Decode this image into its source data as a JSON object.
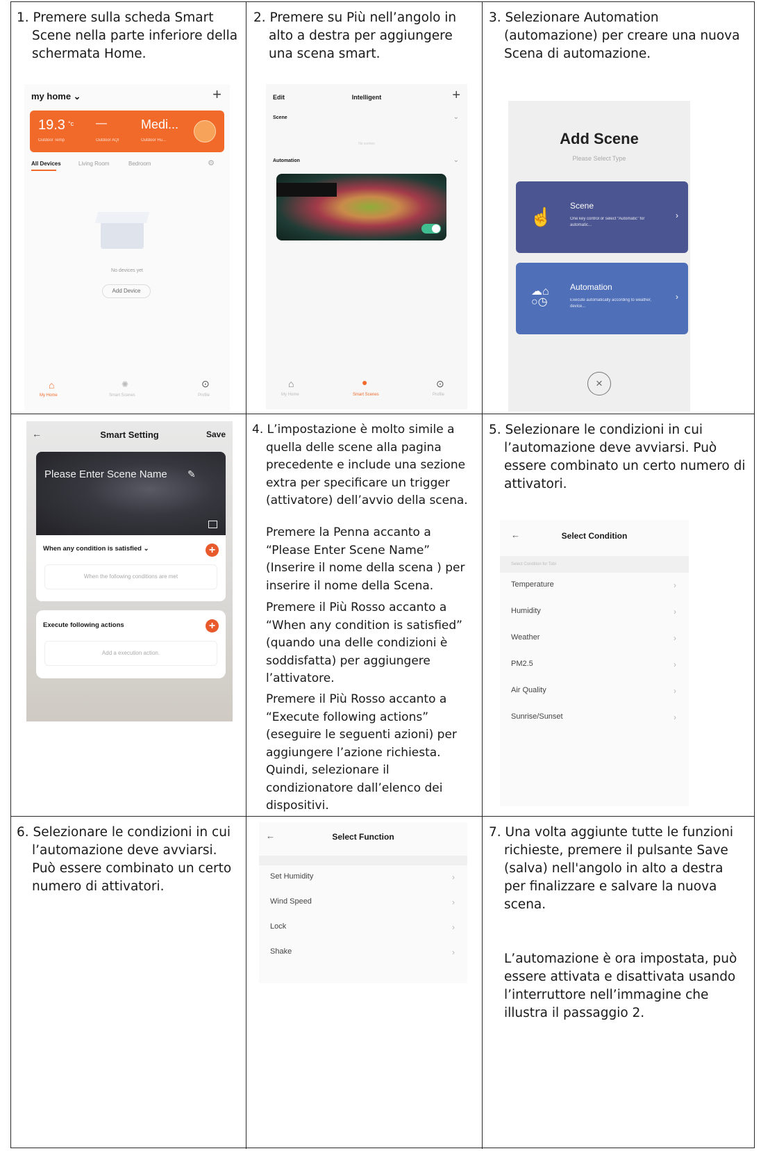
{
  "cells": {
    "c1": {
      "text": "1. Premere sulla scheda Smart Scene nella parte inferiore della schermata Home."
    },
    "c2": {
      "text": "2. Premere su Più nell’angolo in alto a destra per aggiungere una scena smart."
    },
    "c3": {
      "text": "3. Selezionare Automation (automazione) per creare una nuova Scena di automazione."
    },
    "c4": {
      "p1": "4. L’impostazione è molto simile a quella delle scene alla pagina precedente e include una sezione extra per specificare un trigger (attivatore) dell’avvio della scena.",
      "p2": "Premere la Penna accanto a “Please Enter Scene Name” (Inserire il nome della scena ) per inserire il nome della Scena.",
      "p3": "Premere il Più Rosso accanto a “When any condition is satisfied” (quando una delle condizioni è soddisfatta) per aggiungere l’attivatore.",
      "p4": "Premere il Più Rosso accanto a “Execute following actions” (eseguire le seguenti azioni) per aggiungere l’azione richiesta. Quindi, selezionare il condizionatore dall’elenco dei dispositivi."
    },
    "c5": {
      "text": "5. Selezionare le condizioni in cui l’automazione deve avviarsi. Può essere combinato un certo numero di attivatori."
    },
    "c6": {
      "text": "6. Selezionare le condizioni in cui l’automazione deve avviarsi. Può essere combinato un certo numero di attivatori."
    },
    "c7": {
      "p1": "7. Una volta aggiunte tutte le funzioni richieste, premere il pulsante Save (salva) nell'angolo in alto a destra per finalizzare e salvare la nuova scena.",
      "p2": "L’automazione è ora impostata, può essere attivata e disattivata usando l’interruttore nell’immagine che illustra il passaggio 2."
    }
  },
  "screen1": {
    "home_title": "my home ⌄",
    "temp": "19.3",
    "temp_unit": "°c",
    "dash": "—",
    "medi": "Medi...",
    "sub1": "Outdoor Temp",
    "sub2": "Outdoor AQI",
    "sub3": "Outdoor Hu...",
    "tabs": [
      "All Devices",
      "Living Room",
      "Bedroom"
    ],
    "no_devices": "No devices yet",
    "add_device": "Add Device",
    "nav": [
      "My Home",
      "Smart Scenes",
      "Profile"
    ],
    "accent": "#f26a2a"
  },
  "screen2": {
    "edit": "Edit",
    "title": "Intelligent",
    "scene": "Scene",
    "empty": "No scenes",
    "automation": "Automation",
    "nav": [
      "My Home",
      "Smart Scenes",
      "Profile"
    ],
    "toggle_color": "#3fbf8f"
  },
  "screen3": {
    "title": "Add Scene",
    "subtitle": "Please Select Type",
    "scene_title": "Scene",
    "scene_desc": "One key control or select “Automatic” for automatic...",
    "auto_title": "Automation",
    "auto_desc": "Execute automatically according to weather, device...",
    "scene_color": "#4b5591",
    "auto_color": "#4f6fb8"
  },
  "screen4": {
    "title": "Smart Setting",
    "save": "Save",
    "name_placeholder": "Please Enter Scene Name",
    "condition_header": "When any condition is satisfied ⌄",
    "condition_hint": "When the following conditions are met",
    "actions_header": "Execute following actions",
    "actions_hint": "Add a execution action."
  },
  "screen5": {
    "title": "Select Condition",
    "section": "Select Condition for Tobi",
    "items": [
      "Temperature",
      "Humidity",
      "Weather",
      "PM2.5",
      "Air Quality",
      "Sunrise/Sunset"
    ]
  },
  "screen6": {
    "title": "Select Function",
    "items": [
      "Set Humidity",
      "Wind Speed",
      "Lock",
      "Shake"
    ]
  }
}
